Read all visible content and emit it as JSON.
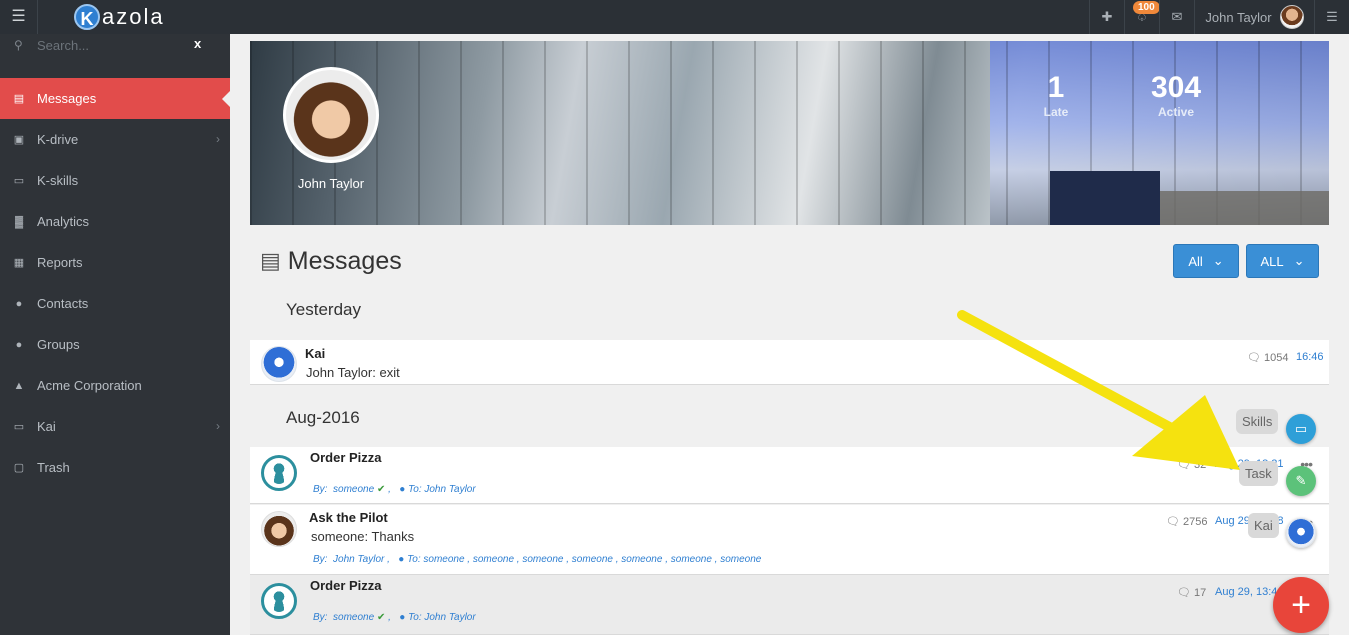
{
  "app": {
    "logo_letter": "K",
    "logo_text": "azola"
  },
  "topbar": {
    "notification_count": "100",
    "user_name": "John Taylor"
  },
  "sidebar": {
    "search_placeholder": "Search...",
    "clear": "x",
    "items": [
      {
        "label": "Messages",
        "icon": "messages-icon",
        "active": true
      },
      {
        "label": "K-drive",
        "icon": "drive-icon",
        "has_children": true
      },
      {
        "label": "K-skills",
        "icon": "laptop-icon"
      },
      {
        "label": "Analytics",
        "icon": "bar-chart-icon"
      },
      {
        "label": "Reports",
        "icon": "table-icon"
      },
      {
        "label": "Contacts",
        "icon": "user-icon"
      },
      {
        "label": "Groups",
        "icon": "users-icon"
      },
      {
        "label": "Acme Corporation",
        "icon": "sitemap-icon"
      },
      {
        "label": "Kai",
        "icon": "laptop-icon",
        "has_children": true
      },
      {
        "label": "Trash",
        "icon": "trash-icon"
      }
    ]
  },
  "banner": {
    "profile_name": "John Taylor",
    "stats": [
      {
        "value": "1",
        "label": "Late"
      },
      {
        "value": "304",
        "label": "Active"
      }
    ]
  },
  "main": {
    "title": "Messages",
    "filters": [
      {
        "label": "All"
      },
      {
        "label": "ALL"
      }
    ],
    "groups": [
      {
        "label": "Yesterday"
      },
      {
        "label": "Aug-2016"
      }
    ],
    "messages": [
      {
        "title": "Kai",
        "body": "John Taylor: exit",
        "count": "1054",
        "time": "16:46"
      },
      {
        "title": "Order Pizza",
        "by_label": "By:",
        "by": "someone",
        "to_label": "To:",
        "to": "John Taylor",
        "count": "32",
        "time": "Aug 29, 18:21"
      },
      {
        "title": "Ask the Pilot",
        "body": "someone: Thanks",
        "by_label": "By:",
        "by": "John Taylor",
        "to_label": "To:",
        "to": "someone , someone , someone , someone , someone , someone , someone",
        "count": "2756",
        "time": "Aug 29, 18:48"
      },
      {
        "title": "Order Pizza",
        "by_label": "By:",
        "by": "someone",
        "to_label": "To:",
        "to": "John Taylor",
        "count": "17",
        "time": "Aug 29, 13:4"
      }
    ]
  },
  "fab": {
    "skills_label": "Skills",
    "task_label": "Task",
    "kai_label": "Kai",
    "main_symbol": "+"
  },
  "colors": {
    "accent_red": "#e24c4b",
    "primary_blue": "#3a8fd6",
    "sidebar": "#2f3338",
    "arrow_yellow": "#f5e20f"
  }
}
